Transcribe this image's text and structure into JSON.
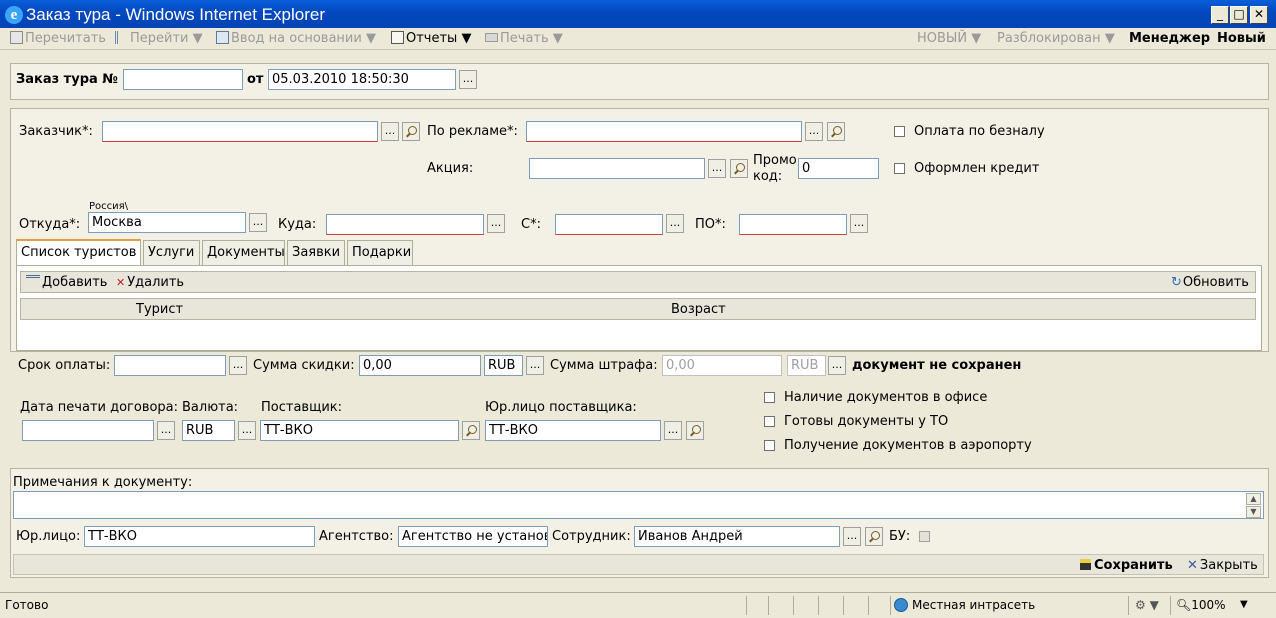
{
  "window": {
    "title": "Заказ тура - Windows Internet Explorer",
    "btn_min": "_",
    "btn_max": "□",
    "btn_close": "✕"
  },
  "toolbar": {
    "reread": "Перечитать",
    "goto": "Перейти",
    "based_on": "Ввод на основании",
    "reports": "Отчеты",
    "print": "Печать",
    "arrow": "▼",
    "state_new": "НОВЫЙ",
    "unlocked": "Разблокирован",
    "role": "Менеджер",
    "mode": "Новый"
  },
  "header": {
    "order_label": "Заказ тура №",
    "order_number": "",
    "from_label": "от",
    "date": "05.03.2010 18:50:30"
  },
  "form": {
    "customer_label": "Заказчик*:",
    "customer": "",
    "ad_label": "По рекламе*:",
    "ad": "",
    "cashless_label": "Оплата по безналу",
    "promo_label": "Акция:",
    "promo": "",
    "promo_code_label_1": "Промо",
    "promo_code_label_2": "код:",
    "promo_code": "0",
    "credit_label": "Оформлен кредит",
    "from_country": "Россия\\",
    "from_label": "Откуда*:",
    "from_city": "Москва",
    "to_label": "Куда:",
    "to": "",
    "date_from_label": "С*:",
    "date_from": "",
    "date_to_label": "ПО*:",
    "date_to": ""
  },
  "tabs": [
    "Список туристов",
    "Услуги",
    "Документы",
    "Заявки",
    "Подарки"
  ],
  "grid": {
    "add": "Добавить",
    "delete": "Удалить",
    "refresh": "Обновить",
    "columns": [
      "Турист",
      "Возраст"
    ]
  },
  "payment": {
    "due_label": "Срок оплаты:",
    "due": "",
    "discount_label": "Сумма скидки:",
    "discount": "0,00",
    "discount_currency": "RUB",
    "penalty_label": "Сумма штрафа:",
    "penalty": "0,00",
    "penalty_currency": "RUB",
    "not_saved": "документ не сохранен"
  },
  "contract": {
    "print_date_label": "Дата печати договора:",
    "print_date": "",
    "currency_label": "Валюта:",
    "currency": "RUB",
    "supplier_label": "Поставщик:",
    "supplier": "ТТ-ВКО",
    "supplier_legal_label": "Юр.лицо поставщика:",
    "supplier_legal": "ТТ-ВКО",
    "docs_in_office": "Наличие документов в офисе",
    "docs_at_to": "Готовы документы у ТО",
    "docs_at_airport": "Получение документов в аэропорту"
  },
  "notes": {
    "label": "Примечания к документу:",
    "text": ""
  },
  "footer": {
    "legal_label": "Юр.лицо:",
    "legal": "ТТ-ВКО",
    "agency_label": "Агентство:",
    "agency": "Агентство не установлено",
    "employee_label": "Сотрудник:",
    "employee": "Иванов Андрей",
    "bu_label": "БУ:",
    "save": "Сохранить",
    "close": "Закрыть"
  },
  "statusbar": {
    "text": "Готово",
    "zone": "Местная интрасеть",
    "zoom": "100%"
  }
}
